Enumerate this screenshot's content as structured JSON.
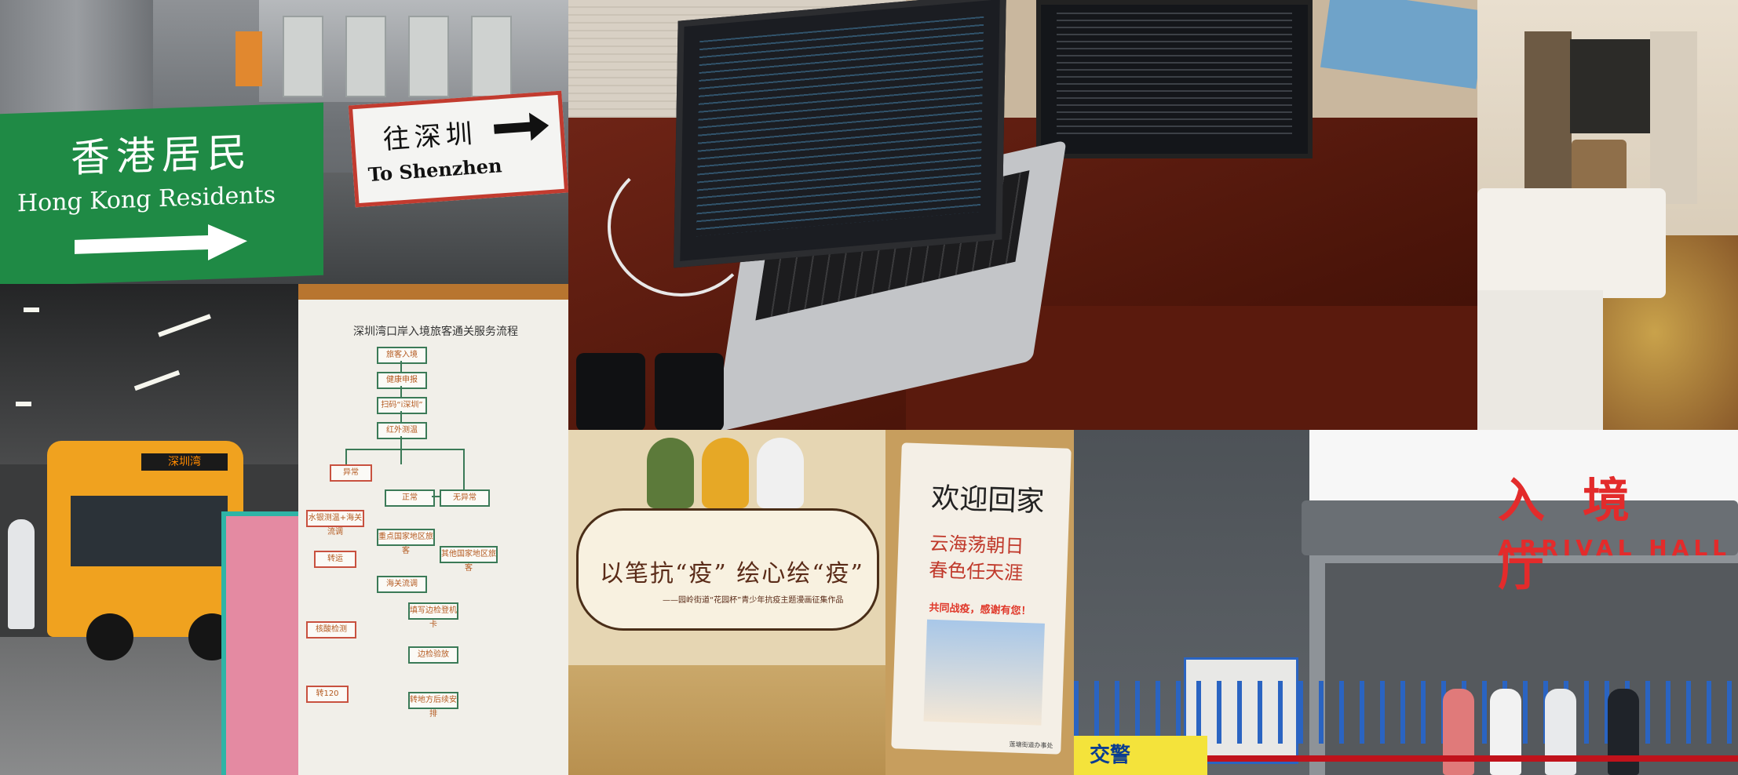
{
  "tiles": {
    "hk_sign": {
      "green_banner_cn": "香港居民",
      "green_banner_en": "Hong Kong Residents",
      "white_sign_cn": "往深圳",
      "white_sign_en": "To Shenzhen"
    },
    "bus": {
      "destination_sign": "深圳湾"
    },
    "flowchart": {
      "title": "深圳湾口岸入境旅客通关服务流程",
      "steps": [
        "旅客入境",
        "健康申报",
        "扫码“i深圳”",
        "红外测温",
        "异常",
        "正常",
        "无异常",
        "水银测温+海关流调",
        "转运",
        "重点国家地区旅客",
        "其他国家地区旅客",
        "海关流调",
        "填写边检登机卡",
        "核酸检测",
        "边检验放",
        "转120",
        "转地方后续安排"
      ]
    },
    "comic_card": {
      "slogan": "以笔抗“疫” 绘心绘“疫”",
      "subtitle": "——园岭街道“花园杯”青少年抗疫主题漫画征集作品"
    },
    "welcome_card": {
      "headline": "欢迎回家",
      "poem_line_1": "云海荡朝日",
      "poem_line_2": "春色任天涯",
      "slogan": "共同战疫，感谢有您！",
      "footer": "莲塘街道办事处"
    },
    "arrival_hall": {
      "sign_cn": "入境厅",
      "sign_en": "ARRIVAL HALL",
      "tent_label": "交警"
    }
  },
  "colors": {
    "banner_green": "#1f8a45",
    "sign_red": "#e32b2b",
    "bus_orange": "#f0a21f",
    "fence_blue": "#2a64c2"
  }
}
